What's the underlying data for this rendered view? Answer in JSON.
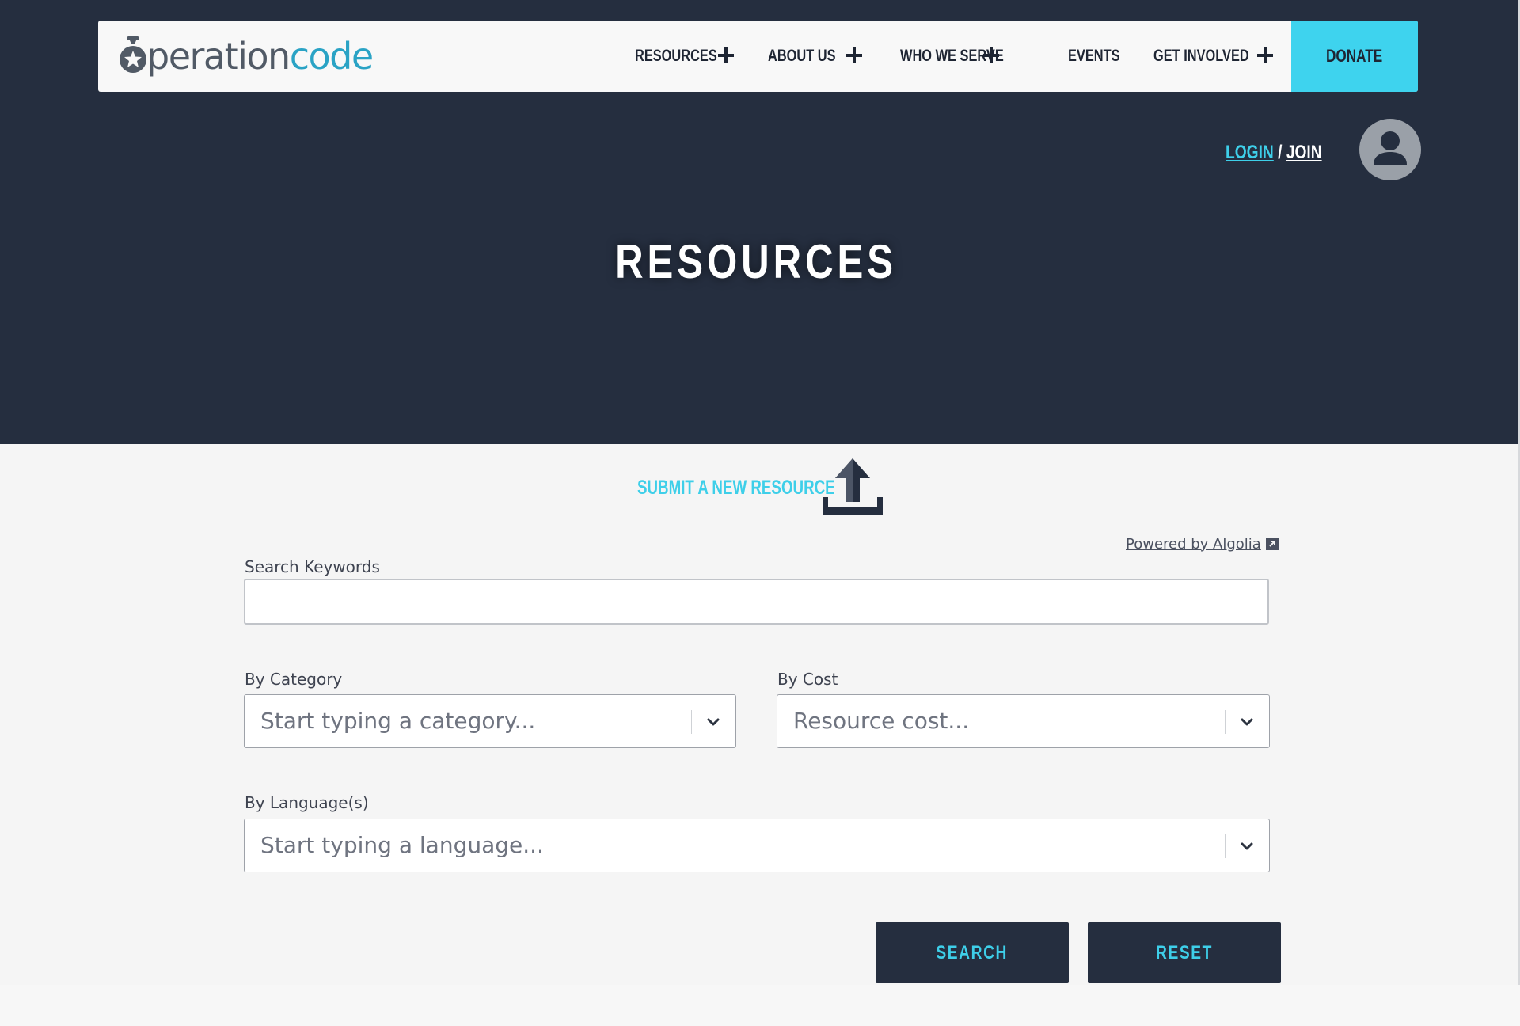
{
  "brand": {
    "logo_op": "peration",
    "logo_code": "code",
    "accent": "#3ed3ee",
    "dark": "#252e3f"
  },
  "nav": {
    "items": [
      {
        "label": "RESOURCES",
        "has_submenu": true
      },
      {
        "label": "ABOUT US",
        "has_submenu": true
      },
      {
        "label": "WHO WE SERVE",
        "has_submenu": true
      },
      {
        "label": "EVENTS",
        "has_submenu": false
      },
      {
        "label": "GET INVOLVED",
        "has_submenu": true
      }
    ],
    "donate": "DONATE"
  },
  "auth": {
    "login": "LOGIN",
    "separator": " / ",
    "join": "JOIN"
  },
  "hero": {
    "title": "RESOURCES"
  },
  "submit": {
    "label": "SUBMIT A NEW RESOURCE"
  },
  "search": {
    "powered_by": "Powered by Algolia",
    "keywords_label": "Search Keywords",
    "keywords_value": "",
    "category_label": "By Category",
    "category_placeholder": "Start typing a category...",
    "cost_label": "By Cost",
    "cost_placeholder": "Resource cost...",
    "language_label": "By Language(s)",
    "language_placeholder": "Start typing a language...",
    "search_button": "SEARCH",
    "reset_button": "RESET"
  }
}
